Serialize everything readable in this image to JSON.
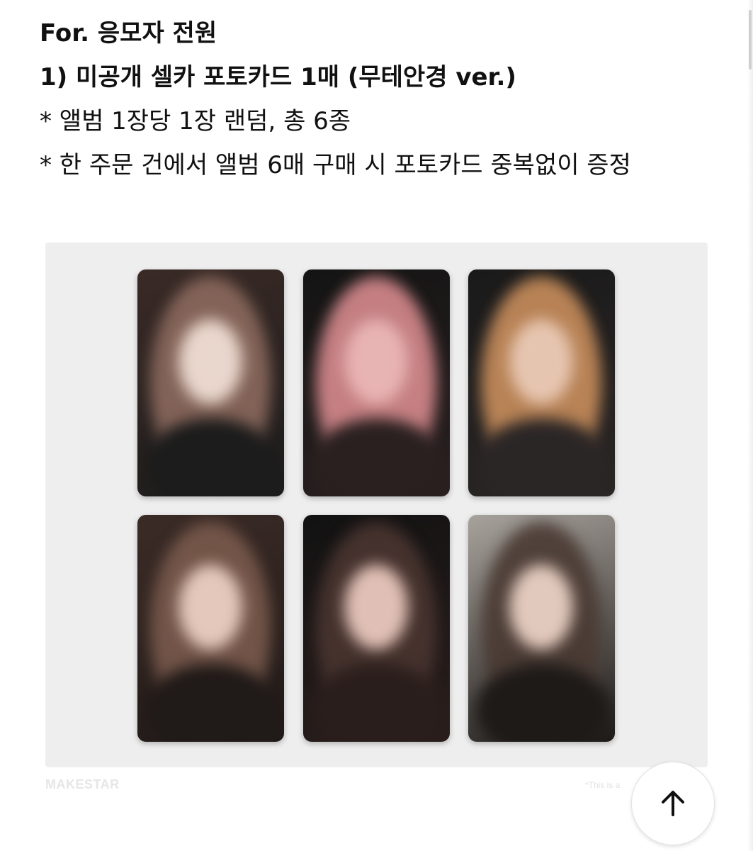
{
  "post": {
    "lines": [
      {
        "text": "For. 응모자 전원",
        "bold": true
      },
      {
        "text": "1) 미공개 셀카 포토카드 1매 (무테안경 ver.)",
        "bold": true
      },
      {
        "text": "* 앨범 1장당 1장 랜덤, 총 6종",
        "bold": false
      },
      {
        "text": "* 한 주문 건에서 앨범 6매 구매 시 포토카드 중복없이 증정",
        "bold": false
      }
    ]
  },
  "image": {
    "watermark_left": "MAKESTAR",
    "watermark_right": "*This is a",
    "panel_color": "#eeeeee",
    "photocards": [
      {
        "label": "photocard-1",
        "palette": [
          "#3a2a26",
          "#8c6a5e",
          "#e9d6cc",
          "#1c1c1c"
        ]
      },
      {
        "label": "photocard-2",
        "palette": [
          "#141414",
          "#d88b8f",
          "#e8b3b3",
          "#2a2020"
        ]
      },
      {
        "label": "photocard-3",
        "palette": [
          "#1a1a1a",
          "#c98e5c",
          "#e6c5b0",
          "#2b2626"
        ]
      },
      {
        "label": "photocard-4",
        "palette": [
          "#3b2b26",
          "#7a5a4d",
          "#e3c8bb",
          "#201a18"
        ]
      },
      {
        "label": "photocard-5",
        "palette": [
          "#121212",
          "#4a3530",
          "#e0c0b6",
          "#2a1e1c"
        ]
      },
      {
        "label": "photocard-6",
        "palette": [
          "#a7a29c",
          "#4a3a33",
          "#e2c9bd",
          "#1e1a18"
        ]
      }
    ]
  },
  "controls": {
    "scroll_top_icon": "arrow-up-icon"
  }
}
